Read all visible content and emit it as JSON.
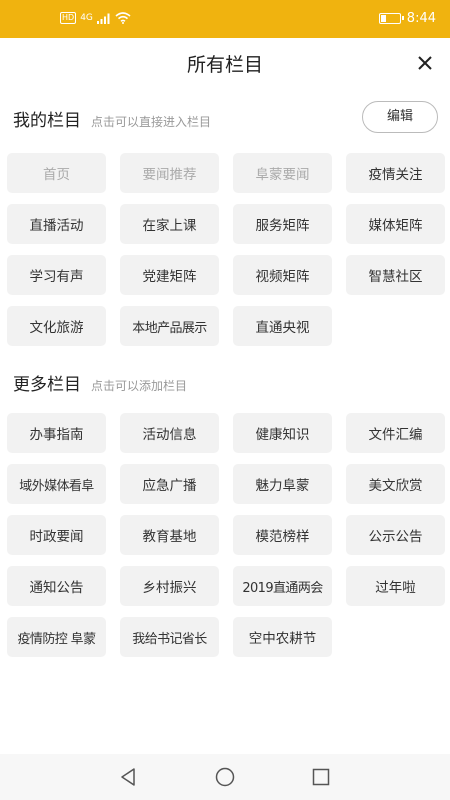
{
  "status_bar": {
    "network_badge": "HD",
    "network_type": "4G",
    "time": "8:44"
  },
  "header": {
    "title": "所有栏目",
    "close_icon": "close-icon"
  },
  "my_section": {
    "title": "我的栏目",
    "hint": "点击可以直接进入栏目",
    "edit_label": "编辑",
    "items": [
      {
        "label": "首页",
        "disabled": true
      },
      {
        "label": "要闻推荐",
        "disabled": true
      },
      {
        "label": "阜蒙要闻",
        "disabled": true
      },
      {
        "label": "疫情关注",
        "disabled": false
      },
      {
        "label": "直播活动",
        "disabled": false
      },
      {
        "label": "在家上课",
        "disabled": false
      },
      {
        "label": "服务矩阵",
        "disabled": false
      },
      {
        "label": "媒体矩阵",
        "disabled": false
      },
      {
        "label": "学习有声",
        "disabled": false
      },
      {
        "label": "党建矩阵",
        "disabled": false
      },
      {
        "label": "视频矩阵",
        "disabled": false
      },
      {
        "label": "智慧社区",
        "disabled": false
      },
      {
        "label": "文化旅游",
        "disabled": false
      },
      {
        "label": "本地产品展示",
        "disabled": false
      },
      {
        "label": "直通央视",
        "disabled": false
      }
    ]
  },
  "more_section": {
    "title": "更多栏目",
    "hint": "点击可以添加栏目",
    "items": [
      {
        "label": "办事指南"
      },
      {
        "label": "活动信息"
      },
      {
        "label": "健康知识"
      },
      {
        "label": "文件汇编"
      },
      {
        "label": "域外媒体看阜"
      },
      {
        "label": "应急广播"
      },
      {
        "label": "魅力阜蒙"
      },
      {
        "label": "美文欣赏"
      },
      {
        "label": "时政要闻"
      },
      {
        "label": "教育基地"
      },
      {
        "label": "模范榜样"
      },
      {
        "label": "公示公告"
      },
      {
        "label": "通知公告"
      },
      {
        "label": "乡村振兴"
      },
      {
        "label": "2019直通两会"
      },
      {
        "label": "过年啦"
      },
      {
        "label": "疫情防控 阜蒙"
      },
      {
        "label": "我给书记省长"
      },
      {
        "label": "空中农耕节"
      }
    ]
  },
  "nav_bar": {
    "icons": [
      "back-icon",
      "home-icon",
      "recents-icon"
    ]
  },
  "colors": {
    "status_bar": "#f0b30f",
    "tile_bg": "#f2f2f2",
    "hint_text": "#999999",
    "disabled_text": "#aaaaaa"
  }
}
